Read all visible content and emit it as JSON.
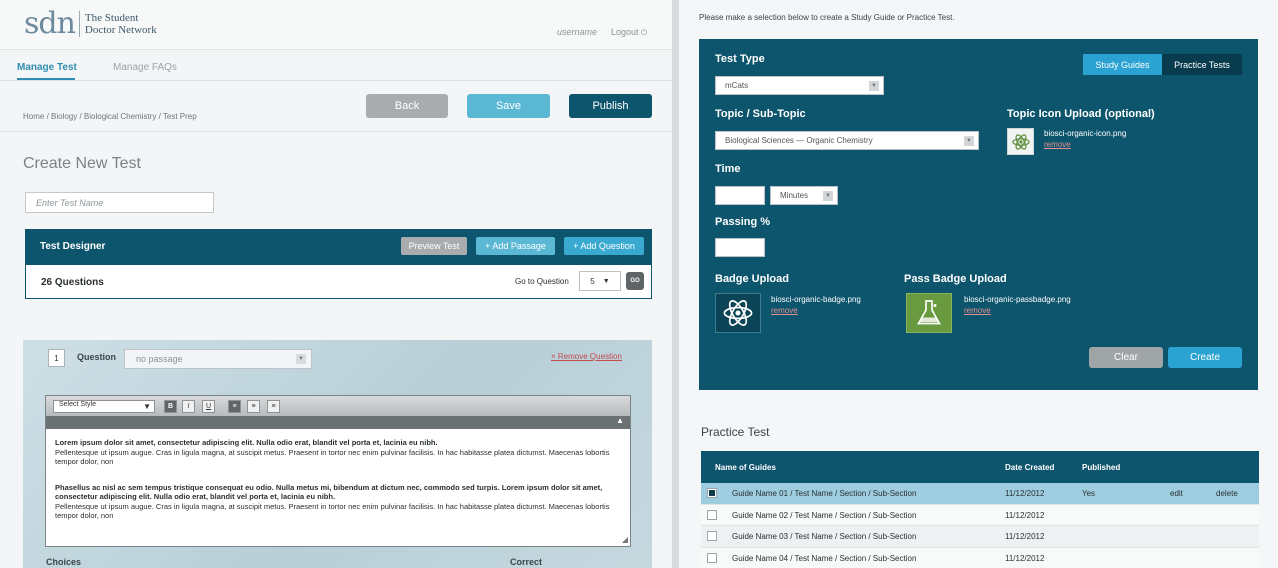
{
  "header": {
    "logo_mark": "sdn",
    "logo_name_line1": "The Student",
    "logo_name_line2": "Doctor Network",
    "username": "username",
    "logout": "Logout"
  },
  "tabs": [
    {
      "label": "Manage Test",
      "active": true
    },
    {
      "label": "Manage FAQs",
      "active": false
    }
  ],
  "breadcrumb": "Home /  Biology  /  Biological Chemistry / Test Prep",
  "actions": {
    "back": "Back",
    "save": "Save",
    "publish": "Publish"
  },
  "page_title": "Create New Test",
  "test_name_placeholder": "Enter Test Name",
  "designer": {
    "title": "Test Designer",
    "preview": "Preview Test",
    "add_passage": "+ Add Passage",
    "add_question": "+ Add Question",
    "questions_count": "26 Questions",
    "goto_label": "Go to Question",
    "goto_value": "5",
    "go": "GO"
  },
  "question": {
    "number": "1",
    "label": "Question",
    "passage": "no passage",
    "remove": "Remove Question",
    "editor_style": "Select Style",
    "p1_bold": "Lorem ipsum dolor sit amet, consectetur adipiscing elit. Nulla odio erat, blandit vel porta et, lacinia eu nibh.",
    "p1_rest": "Pellentesque ut ipsum augue. Cras in ligula magna, at suscipit metus. Praesent in tortor nec enim pulvinar facilisis. In hac habitasse platea dictumst. Maecenas lobortis tempor dolor, non",
    "p2_bold": "Phasellus ac nisl ac sem tempus tristique consequat eu odio. Nulla metus mi, bibendum at dictum nec, commodo sed turpis. Lorem ipsum dolor sit amet, consectetur adipiscing elit. Nulla odio erat, blandit vel porta et, lacinia eu nibh.",
    "p2_rest": "Pellentesque ut ipsum augue. Cras in ligula magna, at suscipit metus. Praesent in tortor nec enim pulvinar facilisis. In hac habitasse platea dictumst. Maecenas lobortis tempor dolor, non",
    "choices": "Choices",
    "correct": "Correct"
  },
  "right": {
    "instructions": "Please make a selection below to create a Study Guide or Practice Test.",
    "test_type_label": "Test Type",
    "test_type_value": "mCats",
    "toggle_study": "Study Guides",
    "toggle_practice": "Practice Tests",
    "topic_label": "Topic / Sub-Topic",
    "topic_value": "Biological Sciences — Organic Chemistry",
    "topic_icon_label": "Topic Icon Upload (optional)",
    "topic_icon_file": "biosci-organic-icon.png",
    "remove": "remove",
    "time_label": "Time",
    "time_unit": "Minutes",
    "passing_label": "Passing %",
    "badge_label": "Badge Upload",
    "badge_file": "biosci-organic-badge.png",
    "pass_badge_label": "Pass Badge Upload",
    "pass_badge_file": "biosci-organic-passbadge.png",
    "clear": "Clear",
    "create": "Create"
  },
  "practice": {
    "title": "Practice Test",
    "columns": [
      "Name of Guides",
      "Date Created",
      "Published"
    ],
    "rows": [
      {
        "name": "Guide Name 01 / Test Name / Section / Sub-Section",
        "date": "11/12/2012",
        "published": "Yes",
        "edit": "edit",
        "delete": "delete",
        "selected": true
      },
      {
        "name": "Guide Name 02 / Test Name / Section / Sub-Section",
        "date": "11/12/2012",
        "published": "",
        "edit": "",
        "delete": "",
        "selected": false
      },
      {
        "name": "Guide Name 03 / Test Name / Section / Sub-Section",
        "date": "11/12/2012",
        "published": "",
        "edit": "",
        "delete": "",
        "selected": false
      },
      {
        "name": "Guide Name 04 / Test Name / Section / Sub-Section",
        "date": "11/12/2012",
        "published": "",
        "edit": "",
        "delete": "",
        "selected": false
      }
    ]
  },
  "colors": {
    "accent": "#2f8eb2",
    "panel": "#0d546d",
    "button_light": "#5ab8d4",
    "button_gray": "#9fa4a7"
  }
}
